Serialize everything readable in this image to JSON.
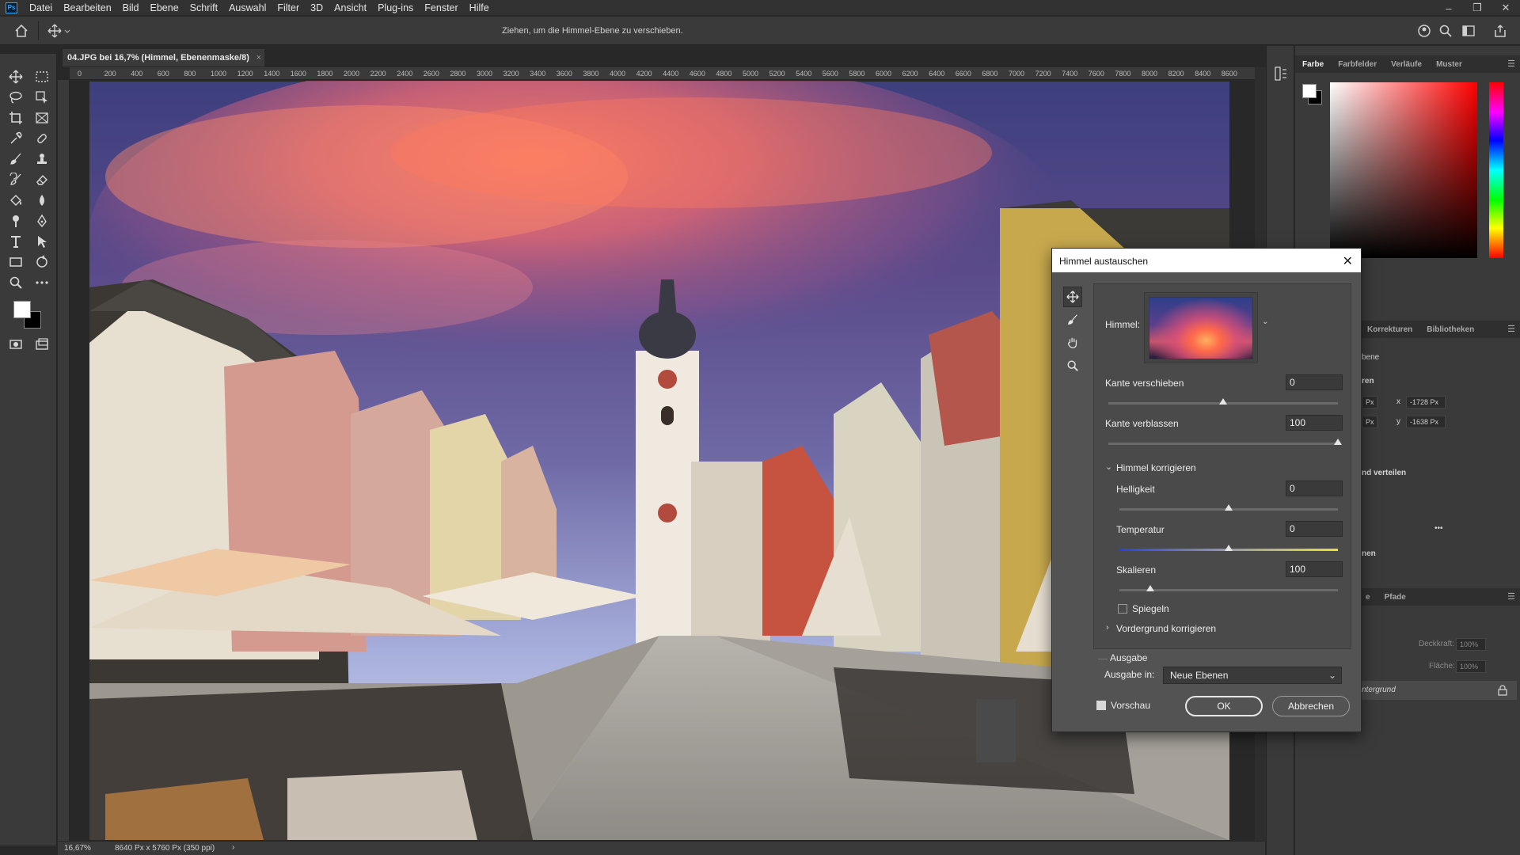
{
  "app": {
    "logo": "Ps",
    "menu": [
      "Datei",
      "Bearbeiten",
      "Bild",
      "Ebene",
      "Schrift",
      "Auswahl",
      "Filter",
      "3D",
      "Ansicht",
      "Plug-ins",
      "Fenster",
      "Hilfe"
    ]
  },
  "options_bar": {
    "hint": "Ziehen, um die Himmel-Ebene zu verschieben."
  },
  "document": {
    "tab_title": "04.JPG bei 16,7% (Himmel, Ebenenmaske/8)",
    "tab_close": "×"
  },
  "rulers": {
    "top_ticks": [
      "0",
      "200",
      "400",
      "600",
      "800",
      "1000",
      "1200",
      "1400",
      "1600",
      "1800",
      "2000",
      "2200",
      "2400",
      "2600",
      "2800",
      "3000",
      "3200",
      "3400",
      "3600",
      "3800",
      "4000",
      "4200",
      "4400",
      "4600",
      "4800",
      "5000",
      "5200",
      "5400",
      "5600",
      "5800",
      "6000",
      "6200",
      "6400",
      "6600",
      "6800",
      "7000",
      "7200",
      "7400",
      "7600",
      "7800",
      "8000",
      "8200",
      "8400",
      "8600"
    ]
  },
  "status": {
    "zoom": "16,67%",
    "size": "8640 Px x 5760 Px (350 ppi)",
    "arrow": "›"
  },
  "color_panel": {
    "tabs": [
      "Farbe",
      "Farbfelder",
      "Verläufe",
      "Muster"
    ],
    "active_tab": "Farbe"
  },
  "properties_panel": {
    "tabs": [
      "Korrekturen",
      "Bibliotheken"
    ],
    "section_layer": "bene",
    "section_transform": "ren",
    "x_label": "x",
    "x_value": "-1728 Px",
    "y_label": "y",
    "y_value": "-1638 Px",
    "w_unit": "Px",
    "h_unit": "Px",
    "align_label": "nd verteilen",
    "more": "•••",
    "section_last": "nen"
  },
  "layers_panel": {
    "tabs": [
      "e",
      "Pfade"
    ],
    "opacity_label": "Deckkraft:",
    "opacity_value": "100%",
    "fill_label": "Fläche:",
    "fill_value": "100%",
    "layer_name": "ntergrund"
  },
  "dialog": {
    "title": "Himmel austauschen",
    "close": "✕",
    "sky_label": "Himmel:",
    "edge_shift_label": "Kante verschieben",
    "edge_shift_value": "0",
    "edge_fade_label": "Kante verblassen",
    "edge_fade_value": "100",
    "sky_adjust_label": "Himmel korrigieren",
    "brightness_label": "Helligkeit",
    "brightness_value": "0",
    "temperature_label": "Temperatur",
    "temperature_value": "0",
    "scale_label": "Skalieren",
    "scale_value": "100",
    "flip_label": "Spiegeln",
    "foreground_label": "Vordergrund korrigieren",
    "output_label": "Ausgabe",
    "output_in_label": "Ausgabe in:",
    "output_in_value": "Neue Ebenen",
    "preview_label": "Vorschau",
    "ok_label": "OK",
    "cancel_label": "Abbrechen"
  },
  "slider_levels": {
    "edge_shift": 0.5,
    "edge_fade": 1.0,
    "brightness": 0.5,
    "temperature": 0.5,
    "scale": 0.14
  },
  "colors": {
    "app_bg": "#282828",
    "panel_bg": "#3a3a3a",
    "dialog_bg": "#535353",
    "foreground": "#ffffff",
    "background": "#000000"
  }
}
